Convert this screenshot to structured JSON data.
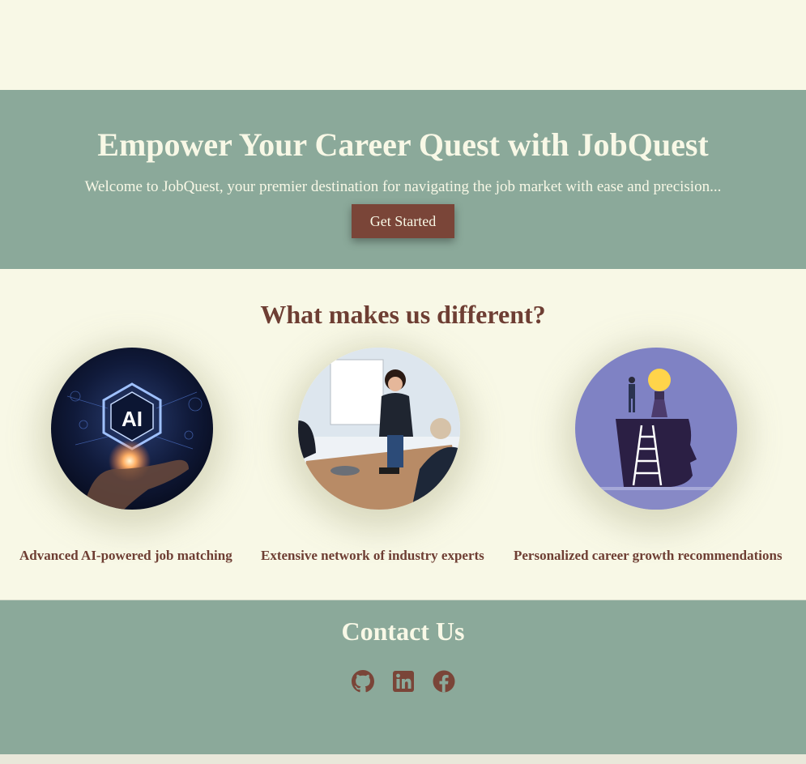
{
  "hero": {
    "title": "Empower Your Career Quest with JobQuest",
    "subtitle": "Welcome to JobQuest, your premier destination for navigating the job market with ease and precision...",
    "cta_label": "Get Started"
  },
  "features": {
    "title": "What makes us different?",
    "items": [
      {
        "label": "Advanced AI-powered job matching",
        "image": "ai-hand-illustration",
        "badge": "AI"
      },
      {
        "label": "Extensive network of industry experts",
        "image": "business-meeting-photo"
      },
      {
        "label": "Personalized career growth recommendations",
        "image": "head-ladder-lightbulb-illustration"
      }
    ]
  },
  "contact": {
    "title": "Contact Us",
    "social": [
      {
        "name": "github-icon"
      },
      {
        "name": "linkedin-icon"
      },
      {
        "name": "facebook-icon"
      }
    ]
  },
  "colors": {
    "background": "#f8f8e6",
    "band": "#8ba99a",
    "accent": "#7a4538",
    "heading_text": "#6e3e33",
    "light_text": "#f8f8e6"
  }
}
